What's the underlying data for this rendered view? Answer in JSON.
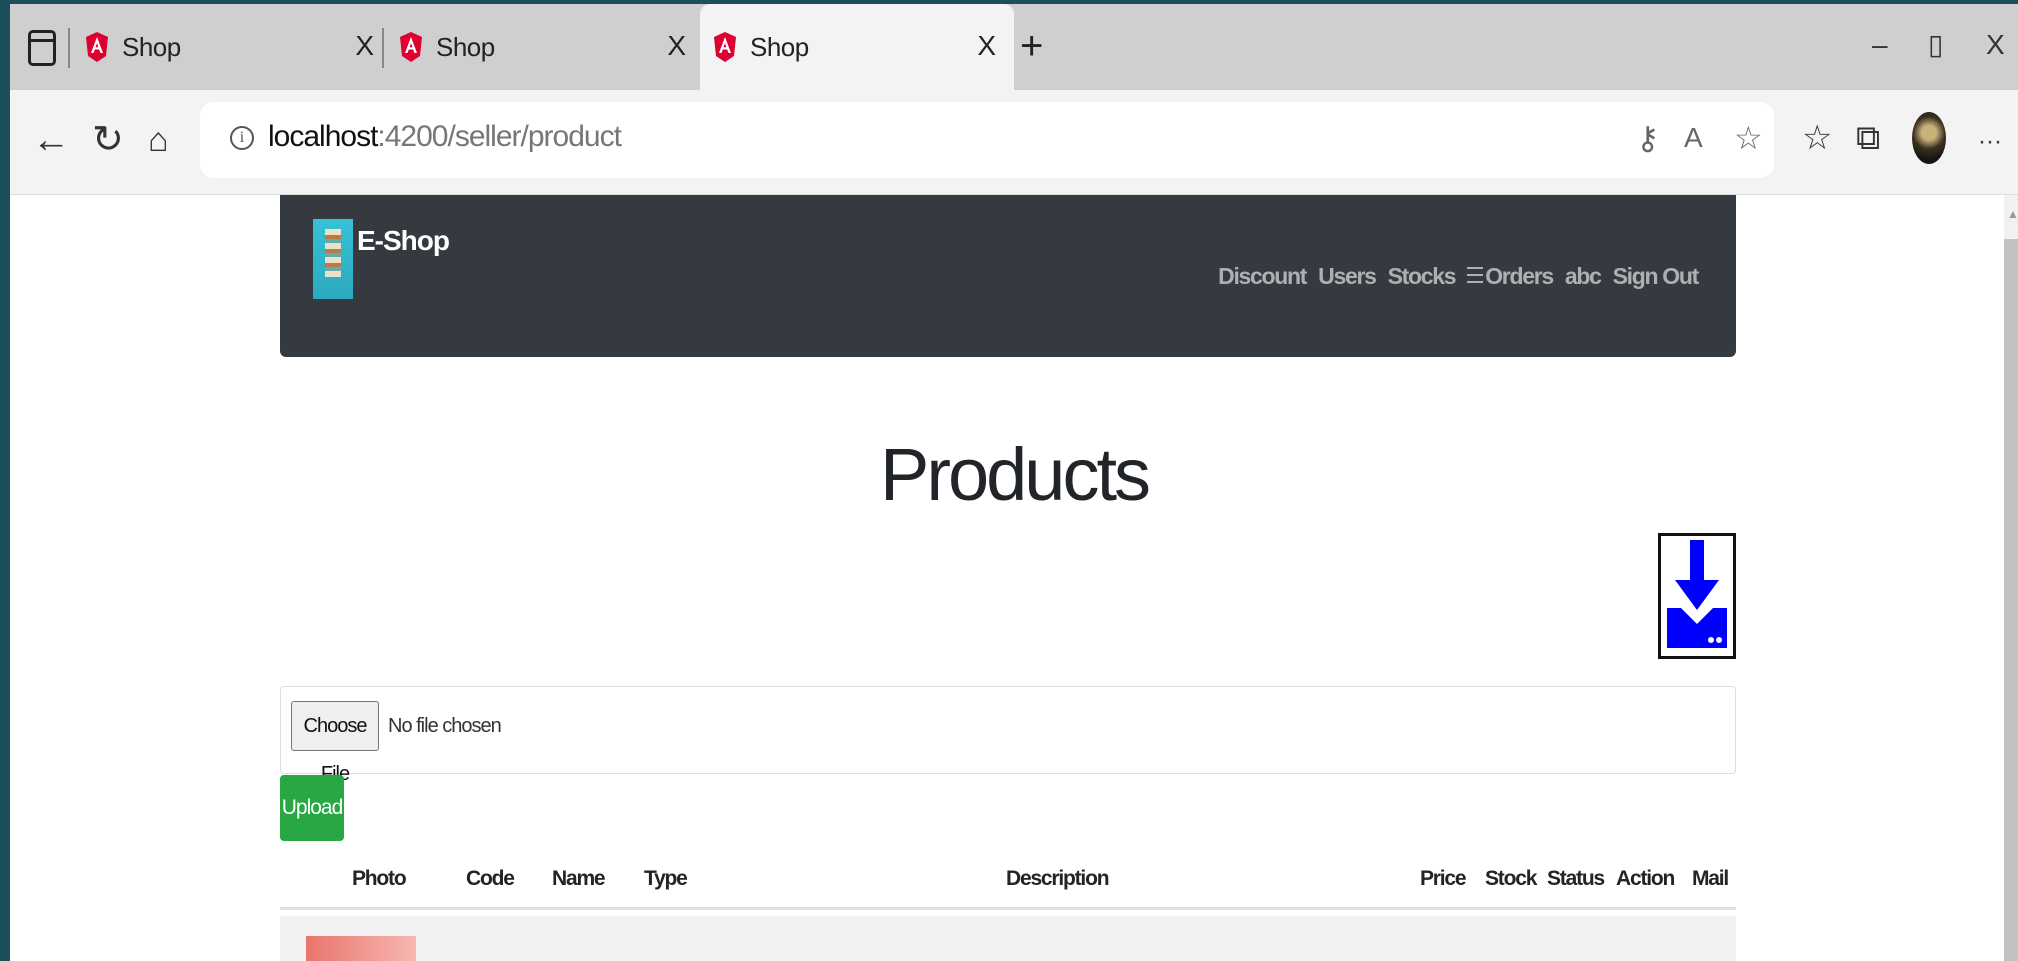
{
  "browser": {
    "tabs": [
      {
        "title": "Shop",
        "close": "X",
        "active": false
      },
      {
        "title": "Shop",
        "close": "X",
        "active": false
      },
      {
        "title": "Shop",
        "close": "X",
        "active": true
      }
    ],
    "new_tab": "+",
    "window_controls": {
      "minimize": "–",
      "restore": "▯",
      "close": "X"
    },
    "url_host": "localhost",
    "url_path": ":4200/seller/product",
    "toolbar_icons": [
      "key-icon",
      "read-aloud-icon",
      "add-favorite-icon",
      "favorites-icon",
      "collections-icon",
      "profile-avatar",
      "more-icon"
    ]
  },
  "app": {
    "brand": "E-Shop",
    "nav": {
      "discount": "Discount",
      "users": "Users",
      "stocks": "Stocks",
      "orders": "Orders",
      "user": "abc",
      "signout": "Sign Out"
    },
    "title": "Products",
    "file_input": {
      "button": "Choose File",
      "status": "No file chosen"
    },
    "upload": "Upload",
    "table": {
      "headers": [
        "Photo",
        "Code",
        "Name",
        "Type",
        "Description",
        "Price",
        "Stock",
        "Status",
        "Action",
        "Mail"
      ]
    }
  },
  "colors": {
    "navbar": "#343a40",
    "upload_button": "#28a745",
    "download_icon": "#0000ff"
  }
}
